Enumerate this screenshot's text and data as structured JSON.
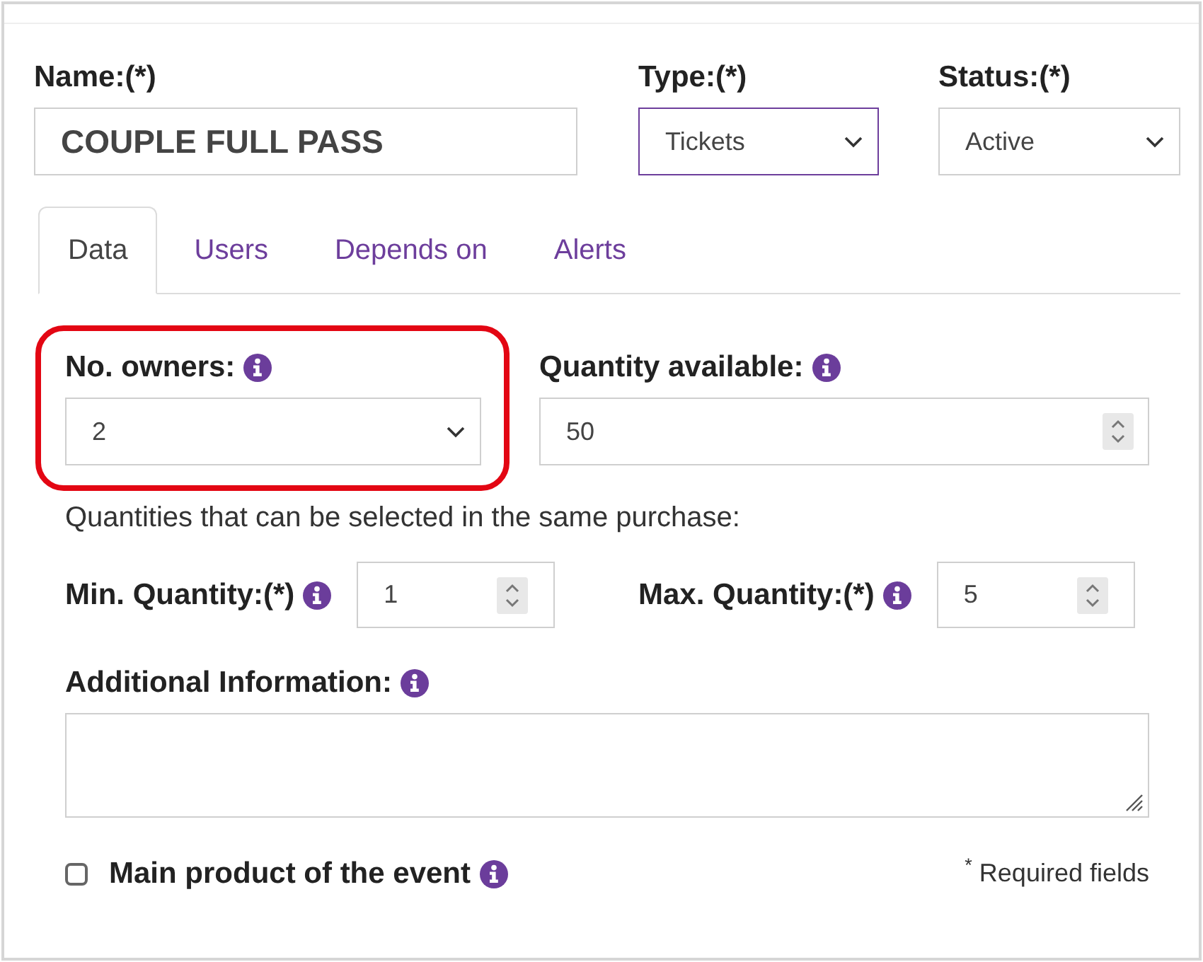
{
  "header_fields": [
    {
      "kind": "text",
      "label": "Name:(*)",
      "value": "COUPLE FULL PASS"
    },
    {
      "kind": "select",
      "label": "Type:(*)",
      "value": "Tickets",
      "focused": true
    },
    {
      "kind": "select",
      "label": "Status:(*)",
      "value": "Active",
      "focused": false
    }
  ],
  "tabs": [
    {
      "label": "Data",
      "selected": true
    },
    {
      "label": "Users",
      "selected": false
    },
    {
      "label": "Depends on",
      "selected": false
    },
    {
      "label": "Alerts",
      "selected": false
    }
  ],
  "owner_fields": [
    {
      "kind": "select",
      "label": "No. owners:",
      "info": true,
      "value": "2",
      "highlighted": true
    },
    {
      "kind": "number",
      "label": "Quantity available:",
      "info": true,
      "value": "50",
      "highlighted": false
    }
  ],
  "purchase_note": "Quantities that can be selected in the same purchase:",
  "quantity_fields": [
    {
      "kind": "number",
      "label": "Min. Quantity:(*)",
      "info": true,
      "value": "1"
    },
    {
      "kind": "number",
      "label": "Max. Quantity:(*)",
      "info": true,
      "value": "5"
    }
  ],
  "additional_info": {
    "label": "Additional Information:",
    "info": true
  },
  "main_product": {
    "label": "Main product of the event",
    "info": true,
    "checked": false
  },
  "required_note": "$^{*}$ Required fields"
}
